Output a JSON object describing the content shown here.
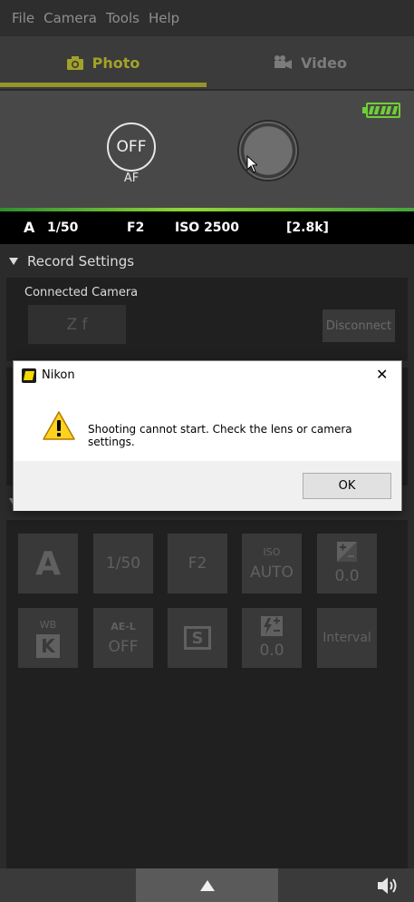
{
  "menu": [
    "File",
    "Camera",
    "Tools",
    "Help"
  ],
  "tabs": {
    "photo": "Photo",
    "video": "Video"
  },
  "camera": {
    "af_button": "OFF",
    "af_label": "AF",
    "battery_level": 1.0
  },
  "status": {
    "mode": "A",
    "shutter": "1/50",
    "aperture": "F2",
    "iso": "ISO 2500",
    "shots": "[2.8k]"
  },
  "record_settings": {
    "header": "Record Settings",
    "connected_camera_label": "Connected Camera",
    "camera_model": "Z f",
    "disconnect": "Disconnect"
  },
  "tiles": [
    {
      "top": "",
      "main": "A",
      "kind": "mode"
    },
    {
      "top": "",
      "main": "1/50",
      "kind": "text"
    },
    {
      "top": "",
      "main": "F2",
      "kind": "text"
    },
    {
      "top": "ISO",
      "main": "AUTO",
      "kind": "text"
    },
    {
      "top": "",
      "main": "0.0",
      "kind": "exposure-comp"
    },
    {
      "top": "WB",
      "main": "K",
      "kind": "wb"
    },
    {
      "top": "AE-L",
      "main": "OFF",
      "kind": "text"
    },
    {
      "top": "",
      "main": "S",
      "kind": "silent"
    },
    {
      "top": "",
      "main": "0.0",
      "kind": "flash-comp"
    },
    {
      "top": "",
      "main": "Interval",
      "kind": "text"
    }
  ],
  "dialog": {
    "title": "Nikon",
    "message": "Shooting cannot start. Check the lens or camera settings.",
    "ok": "OK",
    "close": "✕"
  },
  "colors": {
    "accent": "#a2a229",
    "battery": "#6fcf35",
    "status_bg": "#000000"
  }
}
